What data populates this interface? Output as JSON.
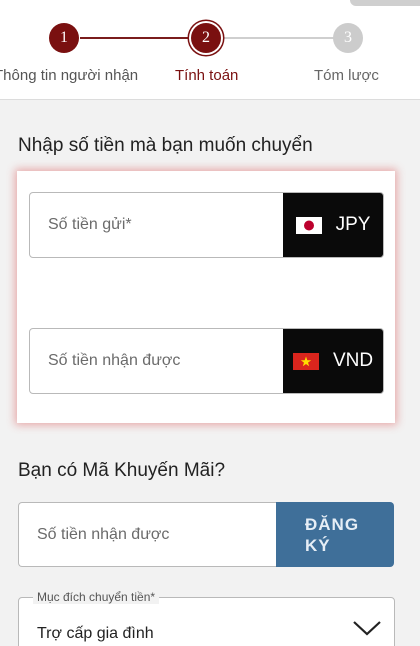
{
  "stepper": {
    "steps": [
      {
        "number": "1",
        "label": "Thông tin người nhận"
      },
      {
        "number": "2",
        "label": "Tính toán"
      },
      {
        "number": "3",
        "label": "Tóm lược"
      }
    ],
    "active_step": 2
  },
  "amount_section": {
    "title": "Nhập số tiền mà bạn muốn chuyển",
    "send": {
      "placeholder": "Số tiền gửi*",
      "currency": "JPY",
      "flag": "japan-flag-icon"
    },
    "receive": {
      "placeholder": "Số tiền nhận được",
      "currency": "VND",
      "flag": "vietnam-flag-icon"
    }
  },
  "promo_section": {
    "title": "Bạn có Mã Khuyến Mãi?",
    "placeholder": "Số tiền nhận được",
    "button_line1": "ĐĂNG",
    "button_line2": "KÝ"
  },
  "purpose": {
    "label": "Mục đích chuyển tiền*",
    "value": "Trợ cấp gia đình"
  },
  "colors": {
    "brand": "#7a1010",
    "button": "#3f6f99",
    "currency_bg": "#0a0a0a"
  }
}
